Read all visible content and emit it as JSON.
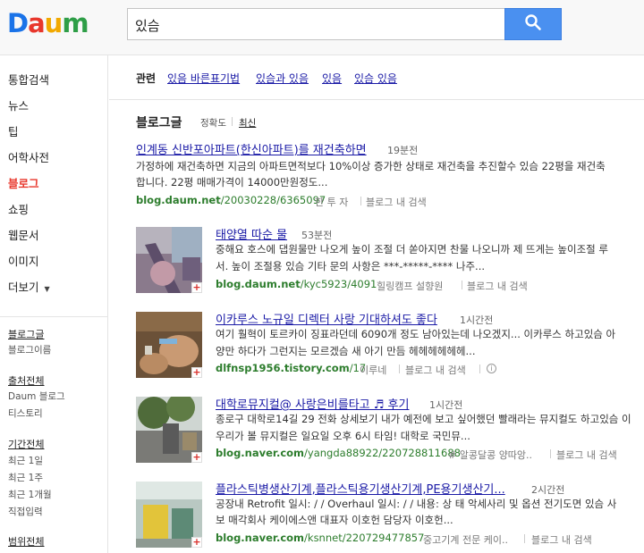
{
  "logo": {
    "letters": [
      "D",
      "a",
      "u",
      "m"
    ],
    "colors": [
      "#1a73e8",
      "#e8372c",
      "#f2a900",
      "#2e9e47"
    ]
  },
  "search": {
    "query": "있슴",
    "button_icon": "search-icon"
  },
  "sidebar": {
    "items": [
      "통합검색",
      "뉴스",
      "팁",
      "어학사전",
      "블로그",
      "쇼핑",
      "웹문서",
      "이미지",
      "더보기"
    ],
    "active_index": 4,
    "filters": [
      {
        "title": "블로그글",
        "options": [
          "블로그이름"
        ]
      },
      {
        "title": "출처전체",
        "options": [
          "Daum 블로그",
          "티스토리"
        ]
      },
      {
        "title": "기간전체",
        "options": [
          "최근 1일",
          "최근 1주",
          "최근 1개월",
          "직접입력"
        ]
      },
      {
        "title": "범위전체",
        "options": []
      }
    ]
  },
  "related": {
    "label": "관련",
    "links": [
      "있음 바른표기법",
      "있슴과 있음",
      "있음",
      "있슴 있음"
    ]
  },
  "section": {
    "title": "블로그글",
    "sort_accuracy": "정확도",
    "sort_recent": "최신"
  },
  "results": [
    {
      "title": "인계동 신반포아파트(한신아파트)를 재건축하면",
      "time": "19분전",
      "snippet": [
        "가정하에 재건축하면 지금의 아파트면적보다 10%이상 증가한 상태로 재건축을 추진할수 있슴 22평을 재건축",
        "합니다. 22평 매매가격이 14000만원정도..."
      ],
      "url_bold": "blog.daum.net",
      "url_rest": "/20030228/6365097",
      "author": "한 투 자",
      "search_in_blog": "블로그 내 검색"
    },
    {
      "title": "태양열 따순 물",
      "time": "53분전",
      "snippet": [
        "중해요 호스에 댑원물만 나오게 높이 조절 더 쏟아지면 찬물 나오니까 제 뜨게는 높이조절 루",
        "서. 높이 조절용 있슴 기타 문의 사항은 ***-*****-**** 나주..."
      ],
      "url_bold": "blog.daum.net",
      "url_rest": "/kyc5923/4091",
      "author": "힐링캠프 설향원",
      "search_in_blog": "블로그 내 검색"
    },
    {
      "title": "이카루스 노규일 디렉터 사랑 기대하셔도 좋다",
      "time": "1시간전",
      "snippet": [
        "여기 훨혁이 토르카이 징표라던데 6090개 정도 남아있는데 나오겠지... 이카루스 하고있슴 아",
        "양만 하다가 그런지는 모르겠슴 새 아기 만듬 헤헤헤헤헤헤..."
      ],
      "url_bold": "dlfnsp1956.tistory.com",
      "url_rest": "/17",
      "author": "이루네",
      "search_in_blog": "블로그 내 검색"
    },
    {
      "title": "대학로뮤지컬@ 사랑은비를타고 ♬ 후기",
      "time": "1시간전",
      "snippet": [
        "종로구 대학로14길 29 전화 상세보기 내가 예전에 보고 싶어했던 빨래라는 뮤지컬도 하고있슴 이",
        "우리가 볼 뮤지컬은 일요일 오후 6시 타임! 대학로 국민뮤..."
      ],
      "url_bold": "blog.naver.com",
      "url_rest": "/yangda88922/220728811688",
      "author": "# 알콩달콩 양따앙..",
      "search_in_blog": "블로그 내 검색"
    },
    {
      "title": "플라스틱병생산기계,플라스틱용기생산기계,PE용기생산기...",
      "time": "2시간전",
      "snippet": [
        "공장내 Retrofit 일시: / / Overhaul 일시: / / 내용: 상 태 악세사리 및 옵션 전기도면 있슴 사",
        "보 매각회사 케이에스앤 대표자 이호헌 담당자 이호헌..."
      ],
      "url_bold": "blog.naver.com",
      "url_rest": "/ksnnet/220729477857",
      "author": "중고기계 전문 케이..",
      "search_in_blog": "블로그 내 검색"
    }
  ],
  "thumb_badge": "+"
}
